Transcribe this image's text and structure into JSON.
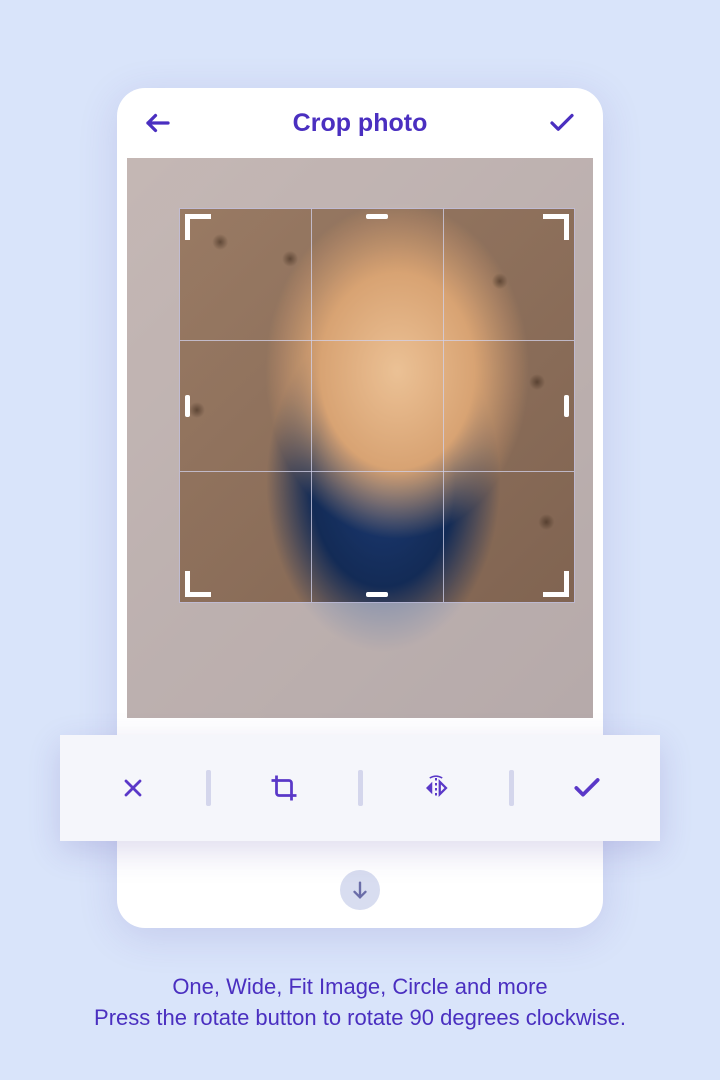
{
  "header": {
    "title": "Crop photo"
  },
  "toolbar": {
    "cancel_icon": "close-icon",
    "crop_icon": "crop-icon",
    "flip_icon": "flip-horizontal-icon",
    "confirm_icon": "check-icon"
  },
  "accent_color": "#4a2fc0",
  "caption": {
    "line1": "One, Wide, Fit Image, Circle and more",
    "line2": "Press the rotate button to rotate 90 degrees clockwise."
  }
}
